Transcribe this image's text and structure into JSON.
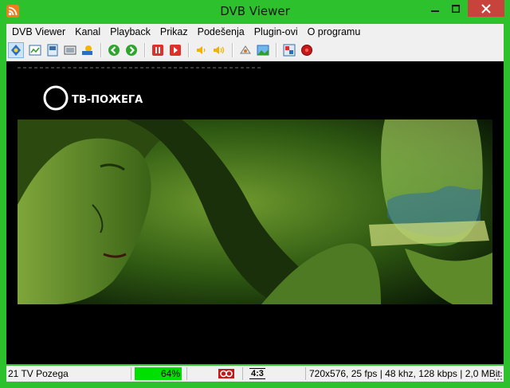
{
  "window": {
    "title": "DVB Viewer",
    "icon": "rss-feed-icon",
    "frame_color": "#2ec12e",
    "close_color": "#c7433b"
  },
  "menu": {
    "items": [
      "DVB Viewer",
      "Kanal",
      "Playback",
      "Prikaz",
      "Podešenja",
      "Plugin-ovi",
      "O programu"
    ]
  },
  "toolbar": {
    "buttons": [
      {
        "icon": "tv-mode-icon",
        "active": true
      },
      {
        "icon": "channel-list-icon"
      },
      {
        "icon": "window-mode-icon"
      },
      {
        "icon": "osd-icon"
      },
      {
        "icon": "epg-icon"
      },
      {
        "icon": "previous-channel-icon"
      },
      {
        "icon": "next-channel-icon"
      },
      {
        "icon": "pause-icon"
      },
      {
        "icon": "play-icon"
      },
      {
        "icon": "volume-down-icon"
      },
      {
        "icon": "volume-up-icon"
      },
      {
        "icon": "snapshot-icon"
      },
      {
        "icon": "picture-icon"
      },
      {
        "icon": "recorder-settings-icon"
      },
      {
        "icon": "record-icon"
      }
    ]
  },
  "video": {
    "channel_logo": "ТВ-ПОЖЕГА"
  },
  "status": {
    "channel": "21 TV Pozega",
    "signal_text": "64%",
    "signal_level": 0.64,
    "signal_color": "#00e000",
    "aspect": "4:3",
    "stream_info": "720x576, 25 fps | 48 khz, 128 kbps | 2,0 MBit"
  }
}
